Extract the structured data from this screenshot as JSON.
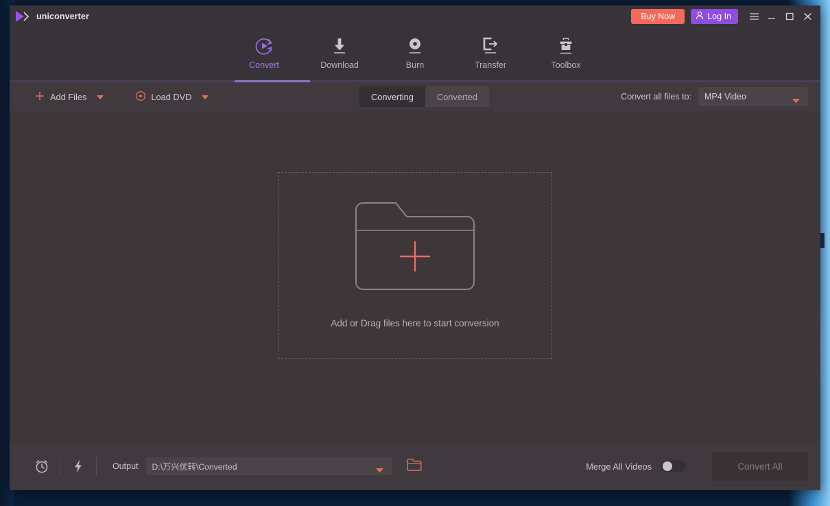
{
  "window": {
    "title": "uniconverter",
    "logo_icon": "play-triangle-icon",
    "buy_now_label": "Buy Now",
    "log_in_label": "Log In",
    "log_in_icon": "user-icon",
    "menu_icon": "hamburger-menu-icon",
    "minimize_icon": "minimize-icon",
    "maximize_icon": "maximize-icon",
    "close_icon": "close-icon",
    "accent_purple": "#8c4de0",
    "accent_salmon": "#f4695a",
    "header_bg": "#373338",
    "body_bg": "#3d3739"
  },
  "nav": {
    "tabs": [
      {
        "label": "Convert",
        "icon": "convert-refresh-play-icon",
        "active": true
      },
      {
        "label": "Download",
        "icon": "download-arrow-icon",
        "active": false
      },
      {
        "label": "Burn",
        "icon": "burn-disc-icon",
        "active": false
      },
      {
        "label": "Transfer",
        "icon": "transfer-export-icon",
        "active": false
      },
      {
        "label": "Toolbox",
        "icon": "toolbox-briefcase-icon",
        "active": false
      }
    ]
  },
  "toolbar": {
    "add_files_label": "Add Files",
    "add_files_icon": "plus-icon",
    "add_files_caret": "chevron-down-icon",
    "load_dvd_label": "Load DVD",
    "load_dvd_icon": "disc-icon",
    "load_dvd_caret": "chevron-down-icon",
    "segments": [
      {
        "label": "Converting",
        "active": true
      },
      {
        "label": "Converted",
        "active": false
      }
    ],
    "convert_all_files_to_label": "Convert all files to:",
    "format_value": "MP4 Video",
    "format_caret": "chevron-down-icon"
  },
  "main": {
    "dropzone_icon": "folder-add-icon",
    "dropzone_plus_icon": "plus-icon",
    "dropzone_text": "Add or Drag files here to start conversion"
  },
  "bottom": {
    "timer_icon": "alarm-clock-icon",
    "speed_icon": "lightning-bolt-icon",
    "output_label": "Output",
    "output_path": "D:\\万兴优转\\Converted",
    "output_caret": "chevron-down-icon",
    "open_folder_icon": "folder-open-icon",
    "merge_label": "Merge All Videos",
    "merge_enabled": false,
    "convert_all_label": "Convert All",
    "convert_all_enabled": false
  }
}
